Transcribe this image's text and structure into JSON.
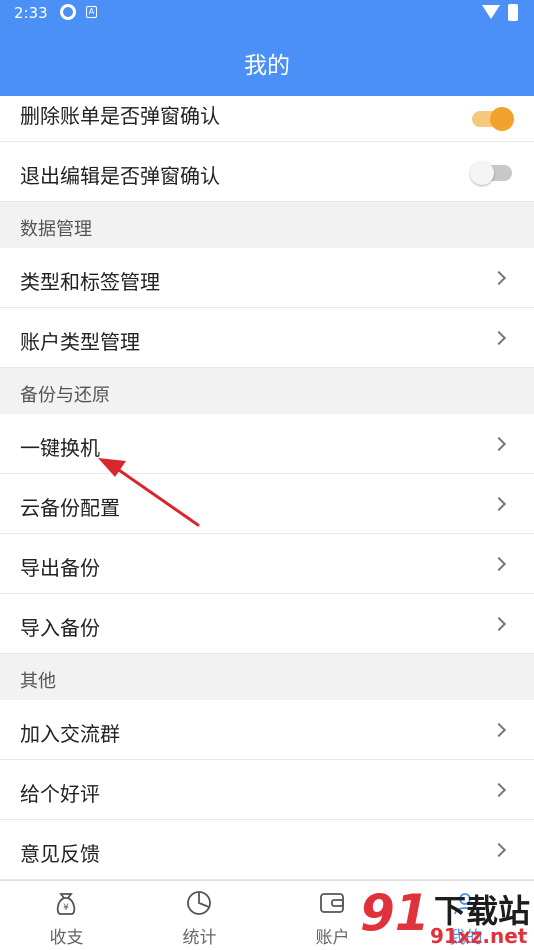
{
  "status_bar": {
    "time": "2:33",
    "icons": [
      "sync-icon",
      "a-icon",
      "wifi-icon",
      "battery-icon"
    ]
  },
  "header": {
    "title": "我的"
  },
  "settings": {
    "confirm_delete": {
      "label": "删除账单是否弹窗确认",
      "enabled": true
    },
    "confirm_exit_edit": {
      "label": "退出编辑是否弹窗确认",
      "enabled": false
    }
  },
  "sections": {
    "data_management": {
      "title": "数据管理",
      "items": [
        {
          "label": "类型和标签管理"
        },
        {
          "label": "账户类型管理"
        }
      ]
    },
    "backup_restore": {
      "title": "备份与还原",
      "items": [
        {
          "label": "一键换机"
        },
        {
          "label": "云备份配置"
        },
        {
          "label": "导出备份"
        },
        {
          "label": "导入备份"
        }
      ]
    },
    "other": {
      "title": "其他",
      "items": [
        {
          "label": "加入交流群"
        },
        {
          "label": "给个好评"
        },
        {
          "label": "意见反馈"
        }
      ]
    }
  },
  "tabbar": {
    "tabs": [
      {
        "label": "收支",
        "icon": "money-bag-icon"
      },
      {
        "label": "统计",
        "icon": "pie-chart-icon"
      },
      {
        "label": "账户",
        "icon": "wallet-icon"
      },
      {
        "label": "我的",
        "icon": "profile-icon"
      }
    ]
  },
  "watermark": {
    "logo_text": "91",
    "site_name": "下载站",
    "domain": "91xz.net"
  },
  "colors": {
    "header": "#4a90f7",
    "toggle_on": "#f1a22d",
    "annotation_arrow": "#d9262c"
  }
}
